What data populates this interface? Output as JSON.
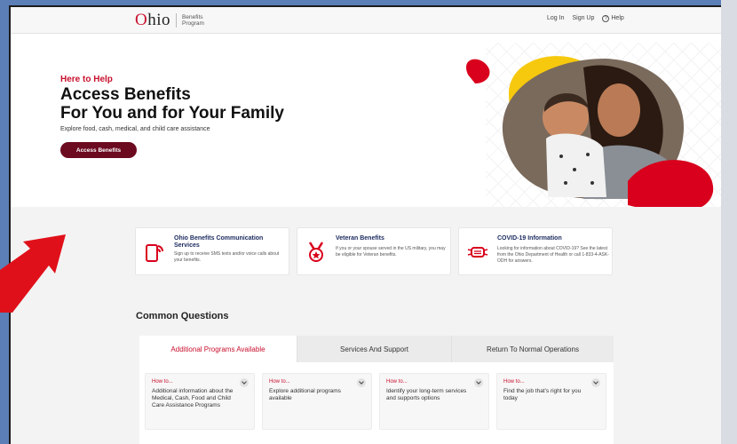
{
  "header": {
    "logo_text": "Ohio",
    "logo_sub_1": "Benefits",
    "logo_sub_2": "Program",
    "login": "Log In",
    "signup": "Sign Up",
    "help": "Help"
  },
  "hero": {
    "eyebrow": "Here to Help",
    "title_line1": "Access Benefits",
    "title_line2": "For You and for Your Family",
    "subtitle": "Explore food, cash, medical, and child care assistance",
    "cta": "Access Benefits"
  },
  "info_cards": [
    {
      "title": "Ohio Benefits Communication Services",
      "text": "Sign up to receive SMS texts and/or voice calls about your benefits.",
      "icon": "phone-message-icon"
    },
    {
      "title": "Veteran Benefits",
      "text": "If you or your spouse served in the US military, you may be eligible for Veteran benefits.",
      "icon": "medal-icon"
    },
    {
      "title": "COVID-19 Information",
      "text": "Looking for information about COVID-19? See the latest from the Ohio Department of Health or call 1-833-4-ASK-ODH for answers.",
      "icon": "face-mask-icon"
    }
  ],
  "common_questions": {
    "title": "Common Questions",
    "tabs": [
      "Additional Programs Available",
      "Services And Support",
      "Return To Normal Operations"
    ],
    "active_tab": 0,
    "items": [
      {
        "howto": "How to...",
        "text": "Additional information about the Medical, Cash, Food and Child Care Assistance Programs"
      },
      {
        "howto": "How to...",
        "text": "Explore additional programs available"
      },
      {
        "howto": "How to...",
        "text": "Identify your long-term services and supports options"
      },
      {
        "howto": "How to...",
        "text": "Find the job that's right for you today"
      }
    ]
  },
  "colors": {
    "brand_red": "#c8102e",
    "cta": "#6c0a20",
    "annotation_arrow": "#e0101a"
  }
}
